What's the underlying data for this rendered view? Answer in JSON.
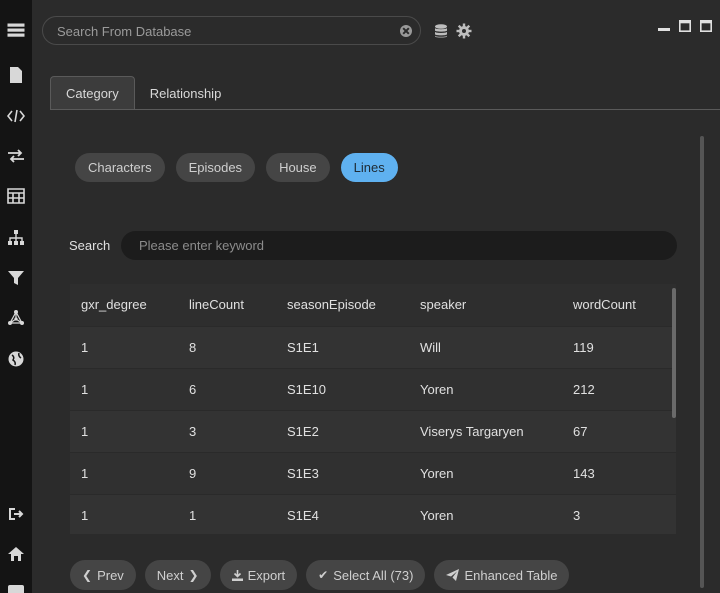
{
  "top_search": {
    "placeholder": "Search From Database"
  },
  "tabs": [
    {
      "label": "Category",
      "active": true
    },
    {
      "label": "Relationship",
      "active": false
    }
  ],
  "categories": [
    {
      "label": "Characters",
      "active": false
    },
    {
      "label": "Episodes",
      "active": false
    },
    {
      "label": "House",
      "active": false
    },
    {
      "label": "Lines",
      "active": true
    }
  ],
  "keyword_search": {
    "label": "Search",
    "placeholder": "Please enter keyword"
  },
  "table": {
    "columns": [
      "gxr_degree",
      "lineCount",
      "seasonEpisode",
      "speaker",
      "wordCount"
    ],
    "rows": [
      [
        "1",
        "8",
        "S1E1",
        "Will",
        "119"
      ],
      [
        "1",
        "6",
        "S1E10",
        "Yoren",
        "212"
      ],
      [
        "1",
        "3",
        "S1E2",
        "Viserys Targaryen",
        "67"
      ],
      [
        "1",
        "9",
        "S1E3",
        "Yoren",
        "143"
      ],
      [
        "1",
        "1",
        "S1E4",
        "Yoren",
        "3"
      ]
    ]
  },
  "buttons": {
    "prev": "Prev",
    "next": "Next",
    "export": "Export",
    "select_all": "Select All (73)",
    "enhanced_table": "Enhanced Table"
  },
  "colors": {
    "accent": "#5fb1f0",
    "rail": "#141414",
    "panel": "#2b2b2b"
  }
}
